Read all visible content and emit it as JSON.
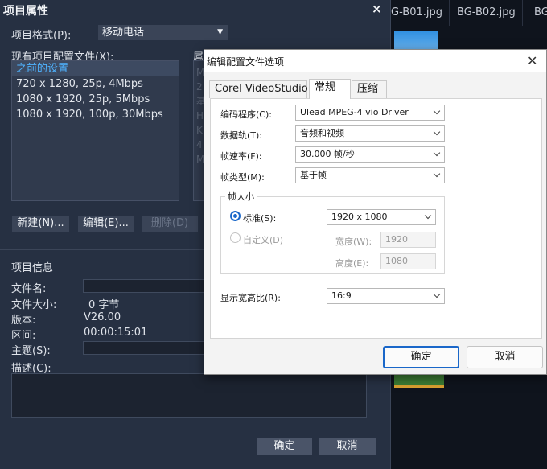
{
  "background_app": {
    "tabs": [
      "G-B01.jpg",
      "BG-B02.jpg",
      "BG"
    ]
  },
  "project_dialog": {
    "title": "项目属性",
    "close_glyph": "×",
    "format_label": "项目格式(P):",
    "format_value": "移动电话",
    "profiles_label": "现有项目配置文件(X):",
    "properties_label": "属",
    "profiles": [
      {
        "label": "之前的设置",
        "selected": true
      },
      {
        "label": "720 x 1280, 25p, 4Mbps",
        "selected": false
      },
      {
        "label": "1080 x 1920, 25p, 5Mbps",
        "selected": false
      },
      {
        "label": "1080 x 1920, 100p, 30Mbps",
        "selected": false
      }
    ],
    "properties_letters": [
      "M",
      "2",
      "基",
      "H",
      "K",
      "4",
      "M"
    ],
    "new_button": "新建(N)...",
    "edit_button": "编辑(E)...",
    "delete_button": "删除(D)",
    "info_heading": "项目信息",
    "file_name_label": "文件名:",
    "file_size_label": "文件大小:",
    "file_size_value": "0 字节",
    "version_label": "版本:",
    "version_value": "V26.00",
    "duration_label": "区间:",
    "duration_value": "00:00:15:01",
    "subject_label": "主题(S):",
    "description_label": "描述(C):",
    "ok_button": "确定",
    "cancel_button": "取消"
  },
  "profile_dialog": {
    "title": "编辑配置文件选项",
    "close_glyph": "✕",
    "tabs": [
      {
        "label": "Corel VideoStudio",
        "active": false
      },
      {
        "label": "常规",
        "active": true
      },
      {
        "label": "压缩",
        "active": false
      }
    ],
    "encoder_label": "编码程序(C):",
    "encoder_value": "Ulead MPEG-4 vio Driver",
    "data_track_label": "数据轨(T):",
    "data_track_value": "音频和视频",
    "frame_rate_label": "帧速率(F):",
    "frame_rate_value": "30.000 帧/秒",
    "frame_type_label": "帧类型(M):",
    "frame_type_value": "基于帧",
    "frame_size_group": "帧大小",
    "standard_label": "标准(S):",
    "standard_value": "1920 x 1080",
    "custom_label": "自定义(D)",
    "width_label": "宽度(W):",
    "width_value": "1920",
    "height_label": "高度(E):",
    "height_value": "1080",
    "aspect_label": "显示宽高比(R):",
    "aspect_value": "16:9",
    "ok_button": "确定",
    "cancel_button": "取消"
  }
}
